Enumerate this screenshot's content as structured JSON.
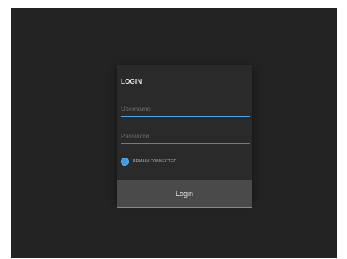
{
  "login": {
    "title": "LOGIN",
    "username_placeholder": "Username",
    "password_placeholder": "Password",
    "remember_label": "REMAIN CONNECTED",
    "remember_checked": true,
    "button_label": "Login"
  },
  "colors": {
    "accent": "#3d9be3",
    "background": "#232323",
    "card": "#2a2a2a",
    "button": "#4a4a4a"
  }
}
